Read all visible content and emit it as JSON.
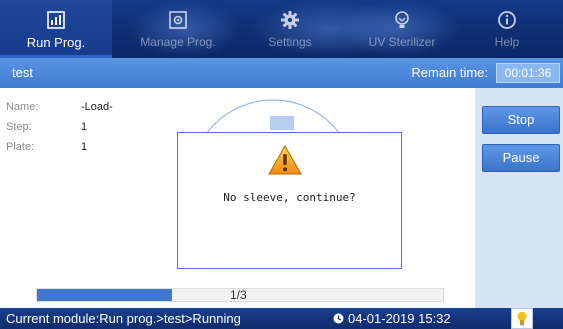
{
  "tabs": [
    {
      "label": "Run Prog.",
      "icon": "run-program-icon"
    },
    {
      "label": "Manage Prog.",
      "icon": "manage-program-icon"
    },
    {
      "label": "Settings",
      "icon": "settings-gear-icon"
    },
    {
      "label": "UV Sterilizer",
      "icon": "uv-lamp-icon"
    },
    {
      "label": "Help",
      "icon": "help-info-icon"
    }
  ],
  "header": {
    "program_name": "test",
    "remain_label": "Remain time:",
    "remain_value": "00:01:36"
  },
  "info": {
    "name_label": "Name:",
    "name_value": "-Load-",
    "step_label": "Step:",
    "step_value": "1",
    "plate_label": "Plate:",
    "plate_value": "1"
  },
  "progress": {
    "text": "1/3",
    "fraction": 0.333
  },
  "side": {
    "stop_label": "Stop",
    "pause_label": "Pause"
  },
  "dialog": {
    "icon": "warning-icon",
    "message": "No sleeve, continue?"
  },
  "status": {
    "module": "Current module:Run prog.>test>Running",
    "datetime": "04-01-2019 15:32",
    "bulb_icon": "light-bulb-icon"
  },
  "colors": {
    "tabbar": "#0f2f74",
    "header": "#4a86da",
    "button": "#3f7ad1",
    "side_panel": "#d5e3f5",
    "progress": "#3f78cf",
    "warning": "#f0a020"
  }
}
